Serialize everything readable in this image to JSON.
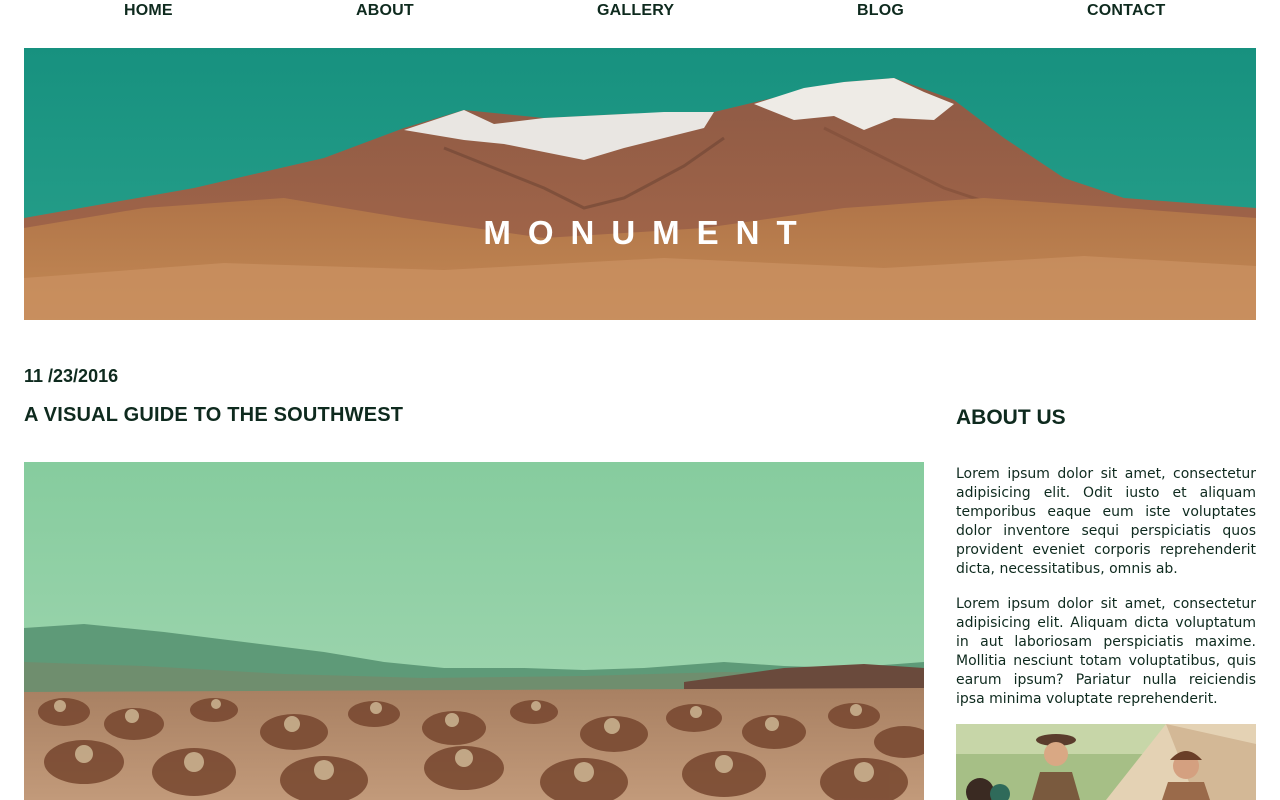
{
  "nav": {
    "items": [
      {
        "label": "HOME"
      },
      {
        "label": "ABOUT"
      },
      {
        "label": "GALLERY"
      },
      {
        "label": "BLOG"
      },
      {
        "label": "CONTACT"
      }
    ]
  },
  "hero": {
    "title": "MONUMENT",
    "image": "mountain-landscape"
  },
  "post": {
    "date": "11 /23/2016",
    "title": "A VISUAL GUIDE TO THE SOUTHWEST",
    "image": "cactus-desert-landscape"
  },
  "sidebar": {
    "title": "ABOUT US",
    "paragraphs": [
      "Lorem ipsum dolor sit amet, consectetur adipisicing elit. Odit iusto et aliquam temporibus eaque eum iste voluptates dolor inventore sequi perspiciatis quos provident eveniet corporis reprehenderit dicta, necessitatibus, omnis ab.",
      "Lorem ipsum dolor sit amet, consectetur adipisicing elit. Aliquam dicta voluptatum in aut laboriosam perspiciatis maxime. Mollitia nesciunt totam voluptatibus, quis earum ipsum? Pariatur nulla reiciendis ipsa minima voluptate reprehenderit."
    ],
    "image": "people-camping-photo"
  },
  "colors": {
    "text": "#0e2a1e",
    "sky_teal": "#1f9a85",
    "desert": "#b87a48",
    "sky_mint": "#8fcfa6"
  }
}
